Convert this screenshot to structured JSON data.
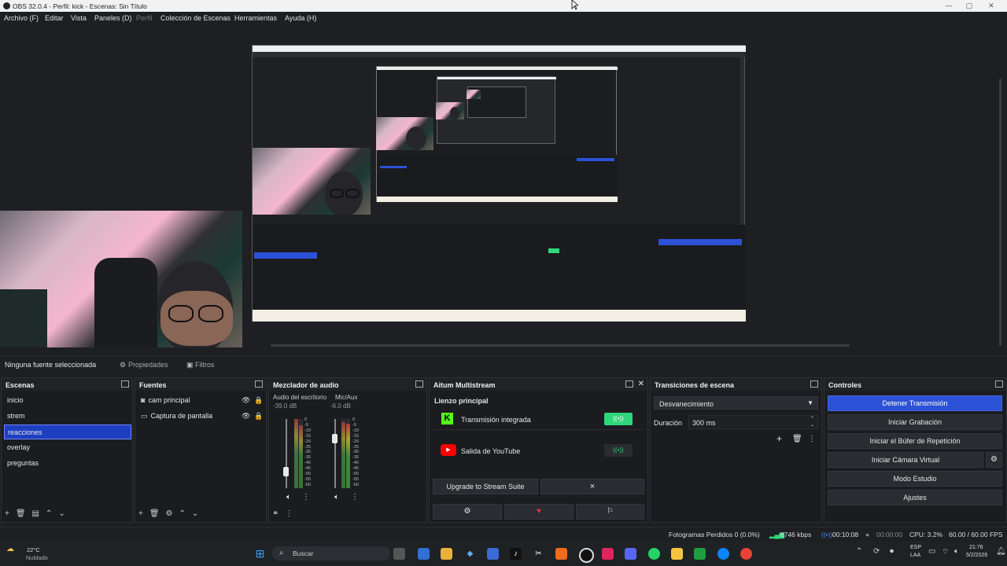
{
  "window": {
    "title": "OBS 32.0.4 - Perfil: kick - Escenas: Sin Título",
    "minimize": "—",
    "maximize": "▢",
    "close": "✕"
  },
  "menu": [
    "Archivo (F)",
    "Editar",
    "Vista",
    "Paneles (D)",
    "Perfil",
    "Colección de Escenas",
    "Herramientas",
    "Ayuda (H)"
  ],
  "source_toolbar": {
    "selection": "Ninguna fuente seleccionada",
    "properties": "Propiedades",
    "filters": "Filtros"
  },
  "scenes": {
    "title": "Escenas",
    "items": [
      "inicio",
      "strem",
      "reacciones",
      "overlay",
      "preguntas"
    ],
    "selected_index": 2
  },
  "sources": {
    "title": "Fuentes",
    "items": [
      {
        "name": "cam principal",
        "type": "camera"
      },
      {
        "name": "Captura de pantalla",
        "type": "monitor"
      }
    ]
  },
  "mixer": {
    "title": "Mezclador de audio",
    "channels": [
      {
        "name": "Audio del escritorio",
        "db": "-39.0 dB",
        "level": 0.2
      },
      {
        "name": "Mic/Aux",
        "db": "-6.0 dB",
        "level": 0.75
      }
    ],
    "scale": [
      "0",
      "-5",
      "-10",
      "-15",
      "-20",
      "-25",
      "-30",
      "-35",
      "-40",
      "-45",
      "-50",
      "-55",
      "-60"
    ]
  },
  "multistream": {
    "title": "Aitum Multistream",
    "canvas_label": "Lienzo principal",
    "outputs": [
      {
        "name": "Transmisión integrada",
        "status": "active"
      },
      {
        "name": "Salida de YouTube",
        "status": "idle"
      }
    ],
    "upgrade_label": "Upgrade to Stream Suite",
    "dismiss_label": "×"
  },
  "transitions": {
    "title": "Transiciones de escena",
    "selected": "Desvanecimiento",
    "duration_label": "Duración",
    "duration_value": "300 ms"
  },
  "controls": {
    "title": "Controles",
    "buttons": [
      "Detener Transmisión",
      "Iniciar Grabación",
      "Iniciar el Búfer de Repetición",
      "Iniciar Cámara Virtual",
      "Modo Estudio",
      "Ajustes"
    ]
  },
  "status": {
    "dropped": "Fotogramas Perdidos 0 (0.0%)",
    "bitrate": "6746 kbps",
    "stream_time": "00:10:08",
    "rec_time": "00:00:00",
    "cpu": "CPU: 3.2%",
    "fps": "60.00 / 60.00 FPS"
  },
  "taskbar": {
    "weather_temp": "22°C",
    "weather_desc": "Nublado",
    "search": "Buscar",
    "lang": "ESP",
    "lang2": "LAA",
    "time": "21:76",
    "date": "5/2/2026"
  },
  "colors": {
    "accent": "#2d51d6",
    "selected": "#1e3fbf",
    "live_green": "#2fd67b",
    "panel_bg": "#1b1c1f"
  }
}
